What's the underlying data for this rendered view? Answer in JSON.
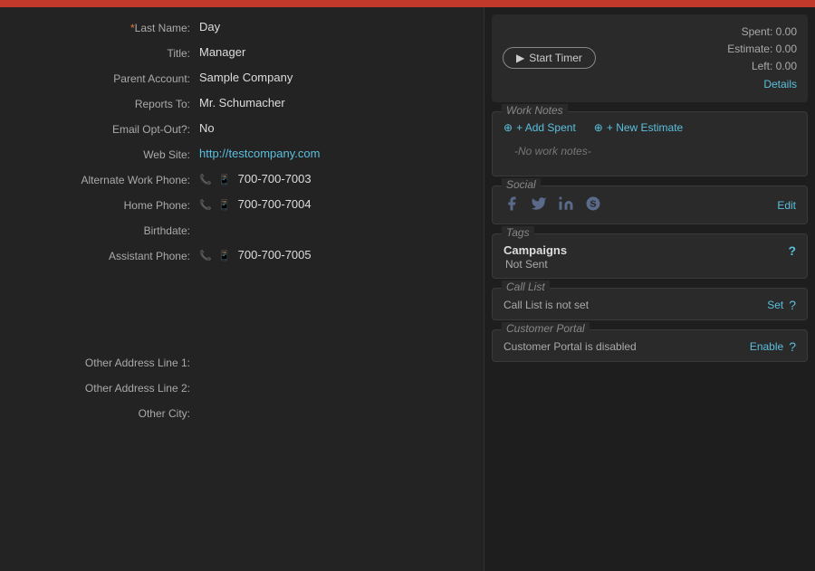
{
  "topbar": {
    "close_color": "#c0392b"
  },
  "left": {
    "fields": [
      {
        "label": "*Last Name:",
        "value": "Day",
        "required": true,
        "type": "text"
      },
      {
        "label": "Title:",
        "value": "Manager",
        "type": "text"
      },
      {
        "label": "Parent Account:",
        "value": "Sample Company",
        "type": "text"
      },
      {
        "label": "Reports To:",
        "value": "Mr. Schumacher",
        "type": "text"
      },
      {
        "label": "Email Opt-Out?:",
        "value": "No",
        "type": "text"
      },
      {
        "label": "Web Site:",
        "value": "http://testcompany.com",
        "type": "link"
      },
      {
        "label": "Alternate Work Phone:",
        "value": "700-700-7003",
        "type": "phone"
      },
      {
        "label": "Home Phone:",
        "value": "700-700-7004",
        "type": "phone"
      },
      {
        "label": "Birthdate:",
        "value": "",
        "type": "text"
      },
      {
        "label": "Assistant Phone:",
        "value": "700-700-7005",
        "type": "phone"
      }
    ],
    "address_fields": [
      {
        "label": "Other Address Line 1:",
        "value": ""
      },
      {
        "label": "Other Address Line 2:",
        "value": ""
      },
      {
        "label": "Other City:",
        "value": ""
      }
    ]
  },
  "right": {
    "timer": {
      "button_label": "Start Timer",
      "spent_label": "Spent:",
      "spent_value": "0.00",
      "estimate_label": "Estimate:",
      "estimate_value": "0.00",
      "left_label": "Left:",
      "left_value": "0.00",
      "details_label": "Details"
    },
    "work_notes": {
      "title": "Work Notes",
      "add_spent_label": "+ Add Spent",
      "new_estimate_label": "+ New Estimate",
      "no_notes": "-No work notes-"
    },
    "social": {
      "title": "Social",
      "edit_label": "Edit",
      "icons": [
        "facebook",
        "twitter",
        "linkedin",
        "skype"
      ]
    },
    "tags": {
      "title": "Tags",
      "campaigns_label": "Campaigns",
      "campaigns_value": "Not Sent"
    },
    "call_list": {
      "title": "Call List",
      "status": "Call List is not set",
      "set_label": "Set"
    },
    "customer_portal": {
      "title": "Customer Portal",
      "status": "Customer Portal is disabled",
      "enable_label": "Enable"
    }
  }
}
